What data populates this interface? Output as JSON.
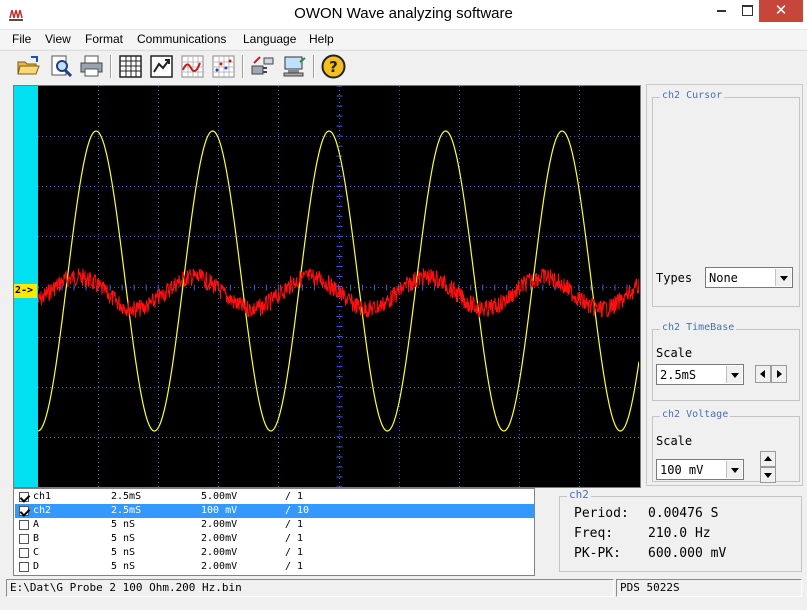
{
  "window": {
    "title": "OWON Wave analyzing software",
    "close_glyph": "✕",
    "app_icon": "app-icon"
  },
  "menu": [
    {
      "label": "File"
    },
    {
      "label": "View"
    },
    {
      "label": "Format"
    },
    {
      "label": "Communications"
    },
    {
      "label": "Language"
    },
    {
      "label": "Help"
    }
  ],
  "toolbar": {
    "buttons": [
      {
        "icon": "open-folder-icon"
      },
      {
        "icon": "preview-magnifier-icon"
      },
      {
        "icon": "printer-icon"
      },
      {
        "icon": "data-table-icon"
      },
      {
        "icon": "export-chart-icon"
      },
      {
        "icon": "waveform-chart-icon"
      },
      {
        "icon": "scatter-grid-icon"
      },
      {
        "icon": "disconnect-plug-icon"
      },
      {
        "icon": "computer-connect-icon"
      },
      {
        "icon": "help-question-icon"
      }
    ]
  },
  "scope": {
    "channel_marker": "2->",
    "colors": {
      "background": "#000000",
      "grid": "#3a5fd8",
      "ch1": "#ffff33",
      "ch2": "#ff1010",
      "left_bar": "#00e0f0"
    }
  },
  "panel": {
    "cursor": {
      "legend": "ch2 Cursor",
      "types_label": "Types",
      "types_value": "None"
    },
    "timebase": {
      "legend": "ch2 TimeBase",
      "scale_label": "Scale",
      "scale_value": "2.5mS"
    },
    "voltage": {
      "legend": "ch2 Voltage",
      "scale_label": "Scale",
      "scale_value": "100 mV"
    }
  },
  "channels": [
    {
      "name": "ch1",
      "timebase": "2.5mS",
      "volts": "5.00mV",
      "probe": "/ 1",
      "checked": true,
      "selected": false
    },
    {
      "name": "ch2",
      "timebase": "2.5mS",
      "volts": "100 mV",
      "probe": "/ 10",
      "checked": true,
      "selected": true
    },
    {
      "name": "A",
      "timebase": "5  nS",
      "volts": "2.00mV",
      "probe": "/ 1",
      "checked": false,
      "selected": false
    },
    {
      "name": "B",
      "timebase": "5  nS",
      "volts": "2.00mV",
      "probe": "/ 1",
      "checked": false,
      "selected": false
    },
    {
      "name": "C",
      "timebase": "5  nS",
      "volts": "2.00mV",
      "probe": "/ 1",
      "checked": false,
      "selected": false
    },
    {
      "name": "D",
      "timebase": "5  nS",
      "volts": "2.00mV",
      "probe": "/ 1",
      "checked": false,
      "selected": false
    }
  ],
  "info": {
    "legend": "ch2",
    "period_label": "Period:",
    "period_value": "0.00476 S",
    "freq_label": "Freq:",
    "freq_value": "210.0 Hz",
    "pkpk_label": "PK-PK:",
    "pkpk_value": "600.000 mV"
  },
  "status": {
    "file_path": "E:\\Dat\\G Probe 2 100 Ohm.200 Hz.bin",
    "device": "PDS 5022S"
  }
}
